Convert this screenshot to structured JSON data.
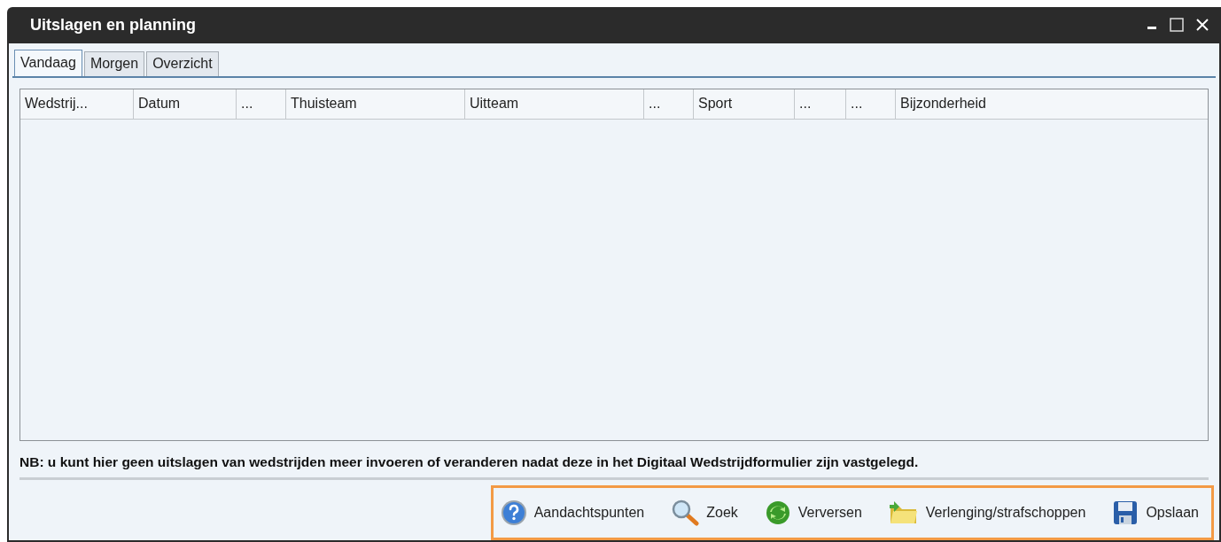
{
  "window": {
    "title": "Uitslagen en planning"
  },
  "tabs": [
    {
      "label": "Vandaag",
      "selected": true
    },
    {
      "label": "Morgen",
      "selected": false
    },
    {
      "label": "Overzicht",
      "selected": false
    }
  ],
  "table": {
    "columns": [
      "Wedstrij...",
      "Datum",
      "...",
      "Thuisteam",
      "Uitteam",
      "...",
      "Sport",
      "...",
      "...",
      "Bijzonderheid"
    ]
  },
  "note": "NB: u kunt hier geen uitslagen van wedstrijden meer invoeren of veranderen nadat deze in het Digitaal Wedstrijdformulier zijn vastgelegd.",
  "toolbar": [
    {
      "kind": "help",
      "label": "Aandachtspunten"
    },
    {
      "kind": "search",
      "label": "Zoek"
    },
    {
      "kind": "refresh",
      "label": "Verversen"
    },
    {
      "kind": "folder",
      "label": "Verlenging/strafschoppen"
    },
    {
      "kind": "save",
      "label": "Opslaan"
    }
  ]
}
